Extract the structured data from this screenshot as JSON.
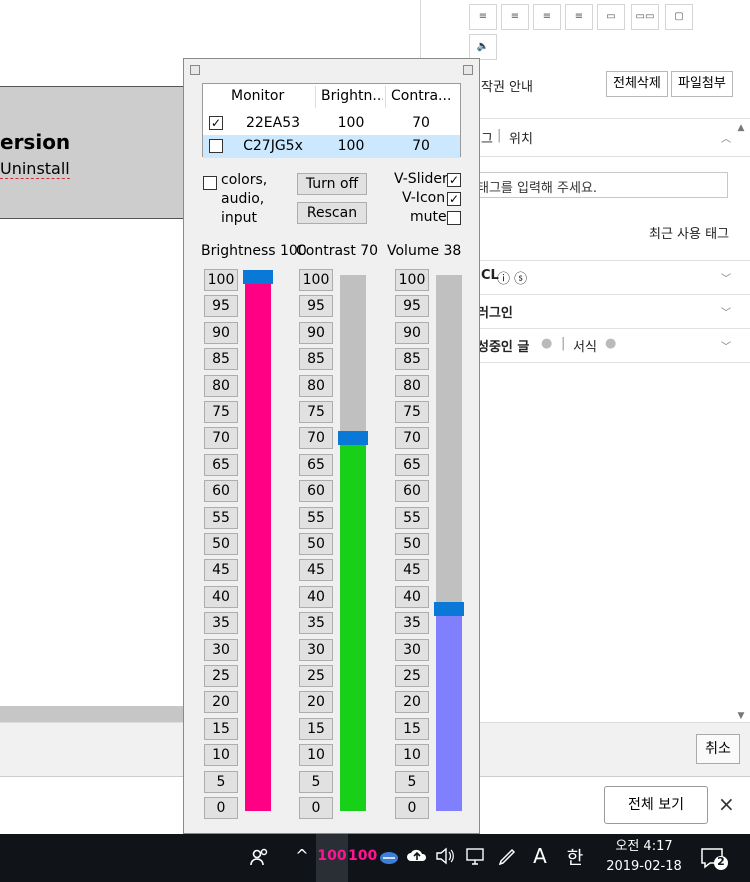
{
  "background_app": {
    "version_heading": "ersion",
    "uninstall_link": "Uninstall"
  },
  "right_panel": {
    "copyright_notice": "작권 안내",
    "delete_all_button": "전체삭제",
    "attach_file_button": "파일첨부",
    "tag_section_label": "그",
    "location_tab": "위치",
    "tag_input_placeholder": "태그를 입력해 주세요.",
    "recent_tags_link": "최근 사용 태그",
    "ccl_section_label": "CL",
    "plugin_section_label": "러그인",
    "draft_section_label": "성중인 글",
    "format_tab": "서식"
  },
  "footer": {
    "cancel_button": "취소",
    "view_all_button": "전체 보기",
    "close_icon": "×"
  },
  "monitor_popup": {
    "table": {
      "headers": [
        "Monitor",
        "Brightn...",
        "Contra..."
      ],
      "rows": [
        {
          "checked": true,
          "monitor": "22EA53",
          "brightness": "100",
          "contrast": "70",
          "selected": false
        },
        {
          "checked": false,
          "monitor": "C27JG5x",
          "brightness": "100",
          "contrast": "70",
          "selected": true
        }
      ]
    },
    "options": {
      "colors_audio_input_line1": "colors,",
      "colors_audio_input_line2": "audio,",
      "colors_audio_input_line3": "input",
      "turn_off_button": "Turn off",
      "rescan_button": "Rescan",
      "v_slider_label": "V-Slider",
      "v_slider_checked": true,
      "v_icon_label": "V-Icon",
      "v_icon_checked": true,
      "mute_label": "mute",
      "mute_checked": false
    },
    "sliders": [
      {
        "id": "brightness",
        "title": "Brightness 100",
        "value": 100,
        "fill_color": "#ff0084"
      },
      {
        "id": "contrast",
        "title": "Contrast 70",
        "value": 70,
        "fill_color": "#18d018"
      },
      {
        "id": "volume",
        "title": "Volume 38",
        "value": 38,
        "fill_color": "#8080ff"
      }
    ],
    "ticks": [
      "100",
      "95",
      "90",
      "85",
      "80",
      "75",
      "70",
      "65",
      "60",
      "55",
      "50",
      "45",
      "40",
      "35",
      "30",
      "25",
      "20",
      "15",
      "10",
      "5",
      "0"
    ]
  },
  "taskbar": {
    "tray_brightness_1": "100",
    "tray_brightness_2": "100",
    "ime_letter": "A",
    "ime_korean": "한",
    "clock_time": "오전 4:17",
    "clock_date": "2019-02-18",
    "notification_count": "2"
  },
  "colors": {
    "thumb": "#0a78d7",
    "table_selected_row": "#cce8ff",
    "taskbar_bg": "#101418"
  }
}
